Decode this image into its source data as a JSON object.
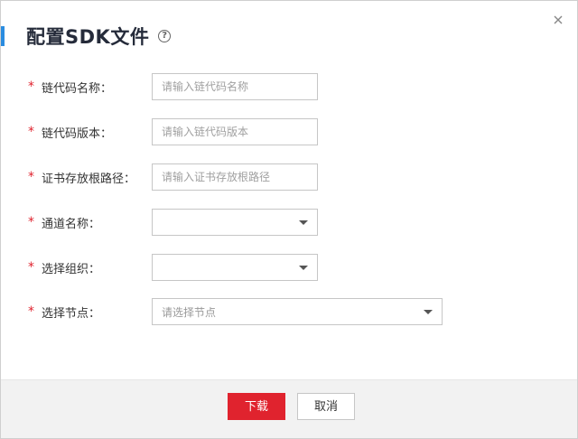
{
  "dialog": {
    "title": "配置SDK文件",
    "help_icon": "help-circle-icon",
    "close_icon": "close-icon",
    "accent_color": "#2a8ce0"
  },
  "form": {
    "fields": [
      {
        "label": "链代码名称：",
        "type": "text",
        "placeholder": "请输入链代码名称",
        "value": ""
      },
      {
        "label": "链代码版本：",
        "type": "text",
        "placeholder": "请输入链代码版本",
        "value": ""
      },
      {
        "label": "证书存放根路径：",
        "type": "text",
        "placeholder": "请输入证书存放根路径",
        "value": ""
      },
      {
        "label": "通道名称：",
        "type": "select",
        "selected": ""
      },
      {
        "label": "选择组织：",
        "type": "select",
        "selected": ""
      },
      {
        "label": "选择节点：",
        "type": "select",
        "selected": "请选择节点"
      }
    ],
    "required_mark": "*",
    "required_color": "#e0232e"
  },
  "footer": {
    "download_label": "下载",
    "cancel_label": "取消",
    "primary_color": "#e0232e"
  }
}
